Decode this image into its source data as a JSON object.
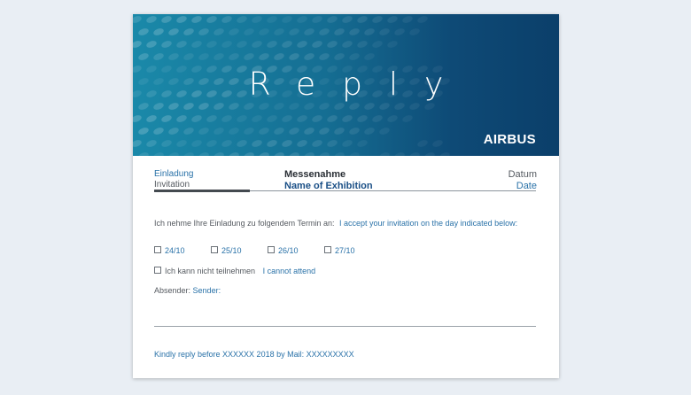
{
  "banner": {
    "title": "Reply",
    "logo": "AIRBUS"
  },
  "header": {
    "left_de": "Einladung",
    "left_en": "Invitation",
    "mid_de": "Messenahme",
    "mid_en": "Name of Exhibition",
    "right_de": "Datum",
    "right_en": "Date"
  },
  "accept": {
    "de": "Ich nehme Ihre Einladung zu folgendem Termin an:",
    "en": "I accept your invitation on the day indicated below:"
  },
  "dates": [
    "24/10",
    "25/10",
    "26/10",
    "27/10"
  ],
  "decline": {
    "de": "Ich kann nicht teilnehmen",
    "en": "I cannot attend"
  },
  "sender": {
    "de": "Absender:",
    "en": "Sender:"
  },
  "footer": "Kindly reply before XXXXXX 2018 by Mail: XXXXXXXXX",
  "colors": {
    "accent": "#2a72a8",
    "banner_left": "#1a89a9",
    "banner_right": "#0b3f6a"
  }
}
